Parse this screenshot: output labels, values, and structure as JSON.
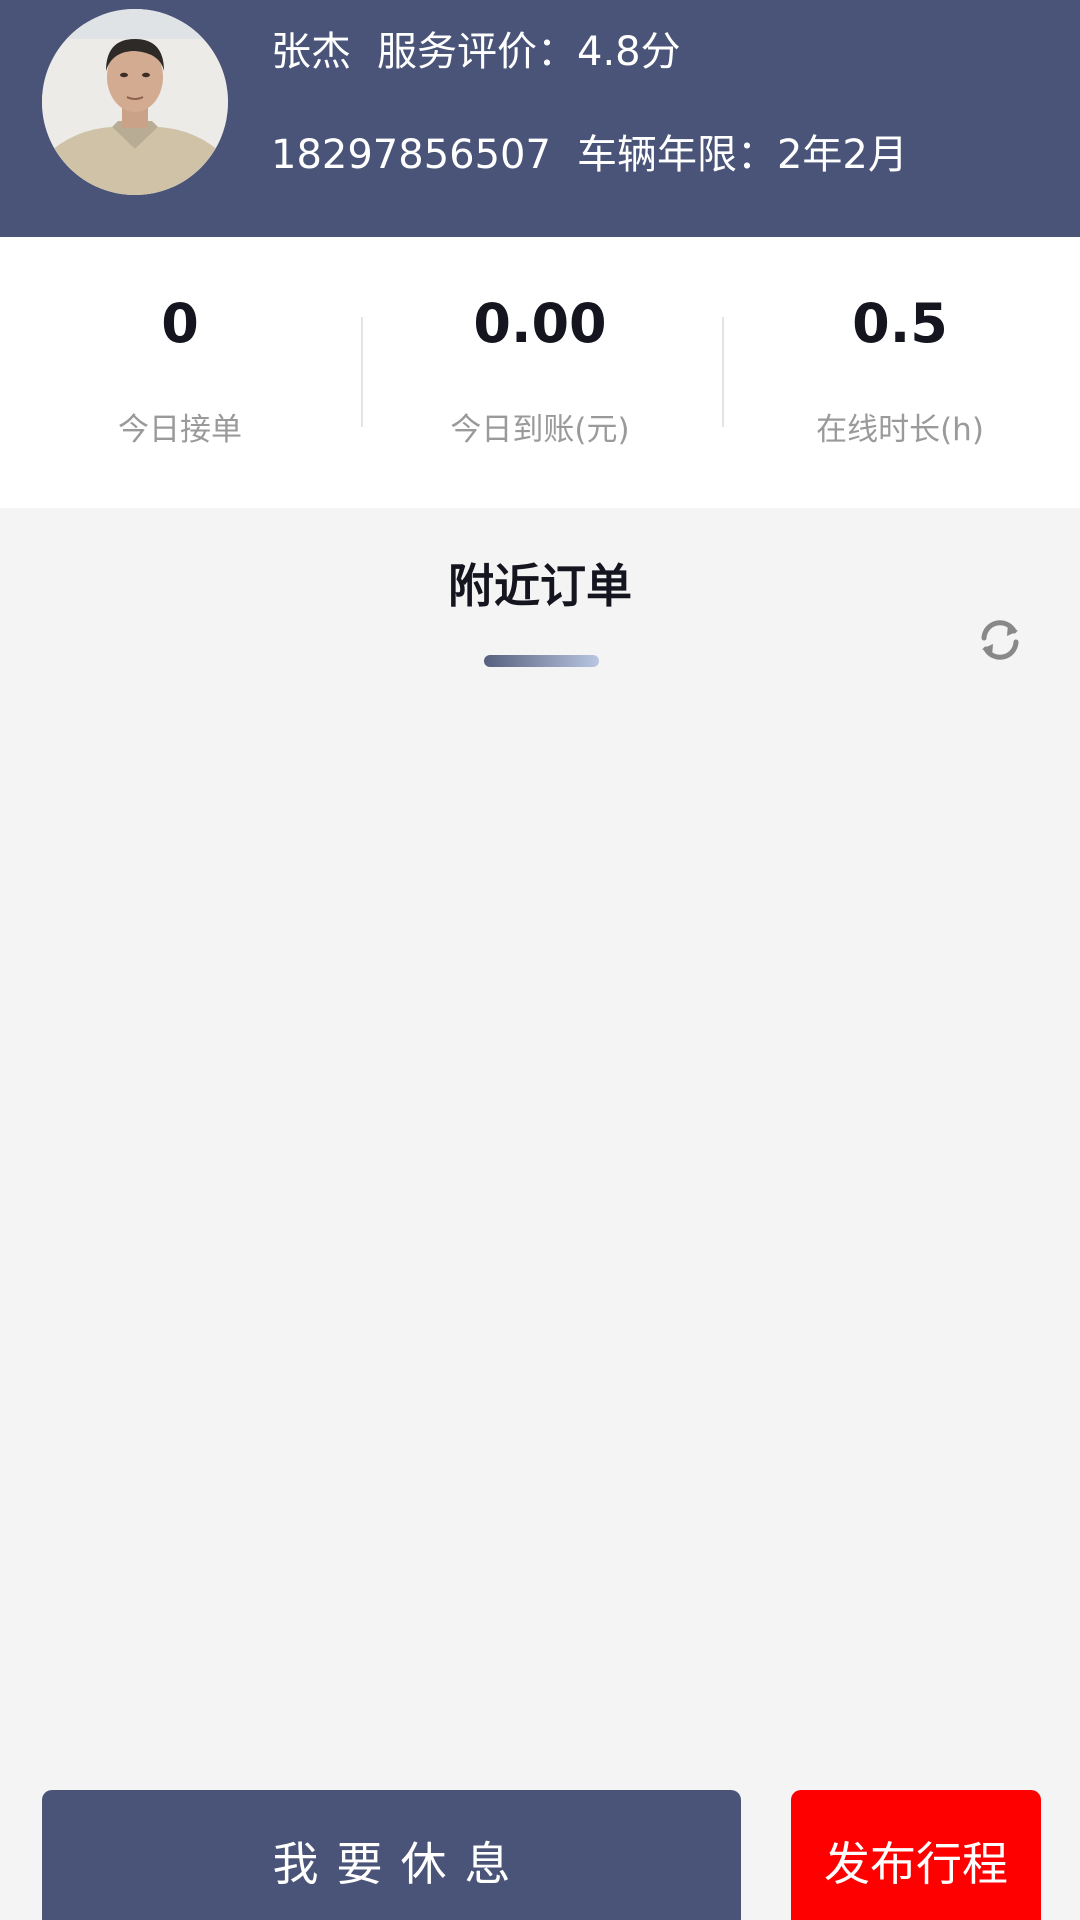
{
  "driver": {
    "name": "张杰",
    "rating_label": "服务评价：",
    "rating_value": "4.8分",
    "phone": "18297856507",
    "vehicle_age_label": "车辆年限：",
    "vehicle_age_value": "2年2月"
  },
  "stats": [
    {
      "value": "0",
      "label": "今日接单"
    },
    {
      "value": "0.00",
      "label": "今日到账(元)"
    },
    {
      "value": "0.5",
      "label": "在线时长(h)"
    }
  ],
  "nearby": {
    "title": "附近订单",
    "refresh_icon": "refresh-icon",
    "orders": []
  },
  "actions": {
    "rest_label": "我要休息",
    "publish_label": "发布行程"
  },
  "colors": {
    "header_bg": "#4a5478",
    "primary_button": "#4a5478",
    "publish_button": "#ff0000",
    "page_bg": "#f4f4f4"
  }
}
